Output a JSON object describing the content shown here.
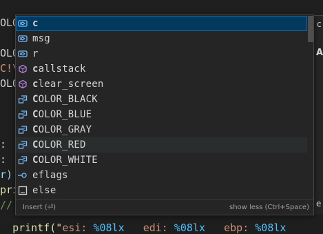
{
  "editor": {
    "line_current_prefix": "();",
    "typed_text": "c",
    "left_fragments": [
      {
        "text": "OLOR_",
        "color": "#d4d4d4"
      },
      {
        "text": "",
        "color": "#d4d4d4"
      },
      {
        "text": "OLOR_",
        "color": "#d4d4d4"
      },
      {
        "text": "C!\\",
        "color": "#ce9178"
      },
      {
        "text": "OLOR_",
        "color": "#d4d4d4"
      },
      {
        "text": "",
        "color": "#d4d4d4"
      },
      {
        "text": "",
        "color": "#d4d4d4"
      },
      {
        "text": "",
        "color": "#d4d4d4"
      },
      {
        "text": ":",
        "color": "#d4d4d4"
      },
      {
        "text": ":",
        "color": "#d4d4d4"
      },
      {
        "text": "r)",
        "color": "#9cdcfe"
      },
      {
        "text": "pri",
        "color": "#dcdcaa"
      },
      {
        "text": "//",
        "color": "#6a9955"
      },
      {
        "text": "pri",
        "color": "#dcdcaa"
      }
    ],
    "bottom_line": {
      "prefix": "printf(\"",
      "a": "esi: ",
      "b": "%08lx",
      "c": "   edi: ",
      "d": "%08lx",
      "e": "   ebp: ",
      "f": "%08lx"
    }
  },
  "suggest": {
    "focused_index": 0,
    "hovered_index": 8,
    "items": [
      {
        "label": "c",
        "icon": "variable-icon"
      },
      {
        "label": "msg",
        "icon": "variable-icon"
      },
      {
        "label": "r",
        "icon": "variable-icon"
      },
      {
        "label": "callstack",
        "icon": "method-icon"
      },
      {
        "label": "clear_screen",
        "icon": "method-icon"
      },
      {
        "label": "COLOR_BLACK",
        "icon": "enum-member-icon"
      },
      {
        "label": "COLOR_BLUE",
        "icon": "enum-member-icon"
      },
      {
        "label": "COLOR_GRAY",
        "icon": "enum-member-icon"
      },
      {
        "label": "COLOR_RED",
        "icon": "enum-member-icon"
      },
      {
        "label": "COLOR_WHITE",
        "icon": "enum-member-icon"
      },
      {
        "label": "eflags",
        "icon": "field-icon"
      },
      {
        "label": "else",
        "icon": "keyword-icon"
      }
    ],
    "status_left": "Insert (⏎)",
    "status_right": "show less (Ctrl+Space)"
  },
  "detail": {
    "top_fragment": "c",
    "heading_fragment": "A",
    "bottom_fragment": "e"
  },
  "colors": {
    "accent_blue": "#75beff",
    "method_purple": "#b180d7",
    "focus_bg": "#04395e"
  }
}
